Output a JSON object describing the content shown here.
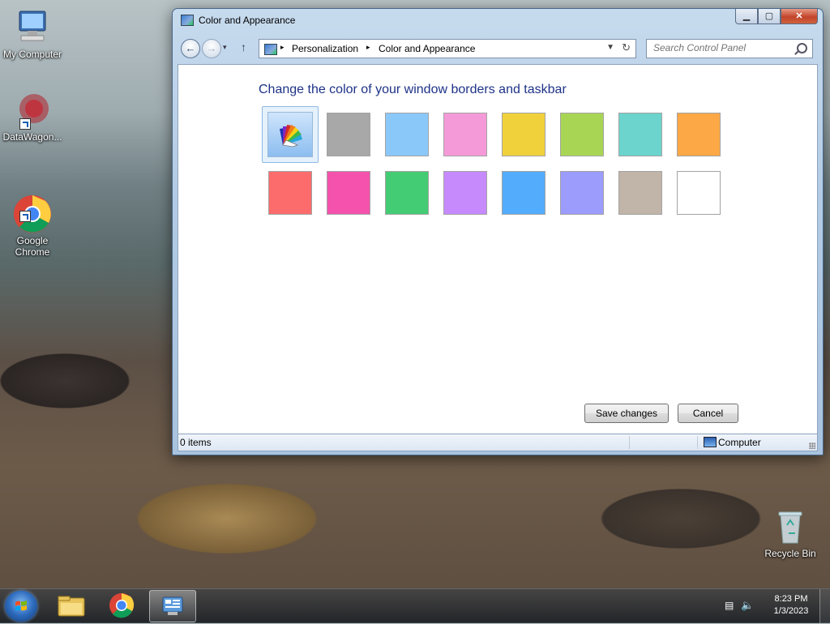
{
  "desktop": {
    "icons": [
      {
        "label": "My Computer"
      },
      {
        "label": "DataWagon..."
      },
      {
        "label": "Google\nChrome"
      },
      {
        "label": "Recycle Bin"
      }
    ]
  },
  "window": {
    "title": "Color and Appearance",
    "controls": {
      "minimize": "▁",
      "maximize": "▢",
      "close": "✕"
    },
    "address": {
      "breadcrumbs": [
        "Personalization",
        "Color and Appearance"
      ]
    },
    "search": {
      "placeholder": "Search Control Panel"
    },
    "heading": "Change the color of your window borders and taskbar",
    "colors": [
      {
        "name": "custom",
        "hex": "#8cbdf0",
        "selected": true
      },
      {
        "name": "gray",
        "hex": "#a8a8a8"
      },
      {
        "name": "sky",
        "hex": "#8ac8fa"
      },
      {
        "name": "pink",
        "hex": "#f59ad8"
      },
      {
        "name": "yellow",
        "hex": "#f0d13c"
      },
      {
        "name": "lime",
        "hex": "#a8d654"
      },
      {
        "name": "teal",
        "hex": "#6cd4cc"
      },
      {
        "name": "orange",
        "hex": "#fca846"
      },
      {
        "name": "red",
        "hex": "#fc6c6c"
      },
      {
        "name": "magenta",
        "hex": "#f452ac"
      },
      {
        "name": "green",
        "hex": "#44cc74"
      },
      {
        "name": "violet",
        "hex": "#c68afc"
      },
      {
        "name": "blue",
        "hex": "#54acfc"
      },
      {
        "name": "periwinkle",
        "hex": "#9c9cfc"
      },
      {
        "name": "taupe",
        "hex": "#c1b4a8"
      },
      {
        "name": "white",
        "hex": "#ffffff"
      }
    ],
    "buttons": {
      "save": "Save changes",
      "cancel": "Cancel"
    },
    "status": {
      "items": "0 items",
      "location": "Computer"
    }
  },
  "taskbar": {
    "apps": [
      {
        "name": "file-explorer-icon"
      },
      {
        "name": "chrome-icon"
      },
      {
        "name": "control-panel-icon",
        "active": true
      }
    ],
    "clock": {
      "time": "8:23 PM",
      "date": "1/3/2023"
    }
  }
}
